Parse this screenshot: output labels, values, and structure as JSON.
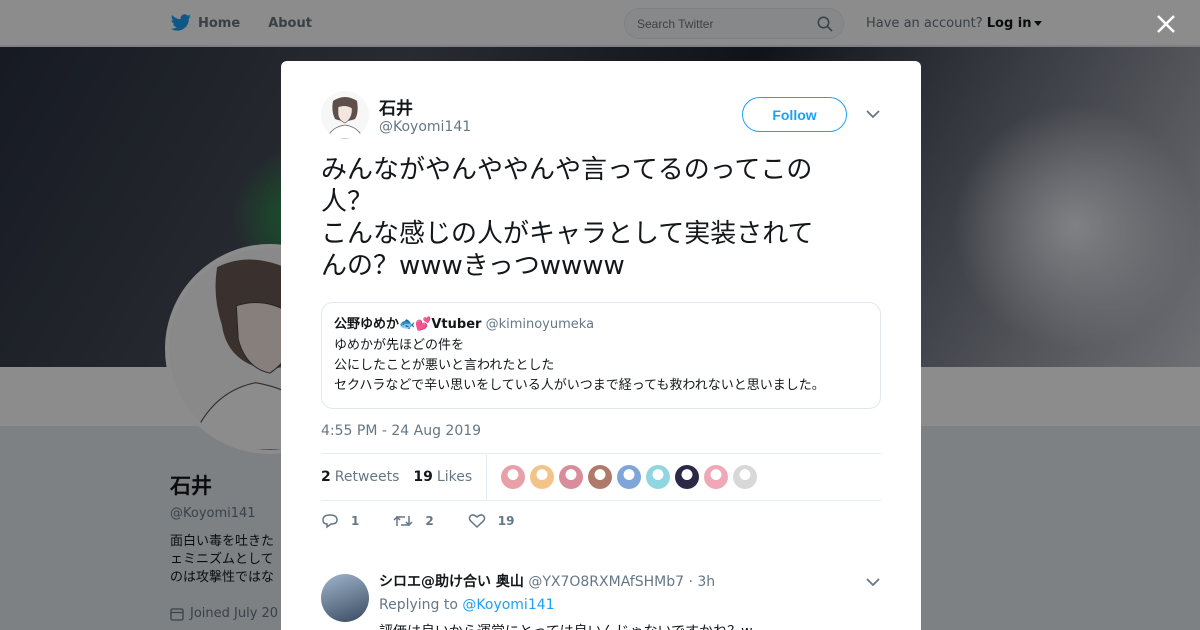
{
  "nav": {
    "home": "Home",
    "about": "About",
    "search_placeholder": "Search Twitter",
    "account_prompt": "Have an account?",
    "login": "Log in"
  },
  "profile": {
    "name": "石井",
    "handle": "@Koyomi141",
    "bio": "面白い毒を吐きた\nェミニズムとして\nのは攻撃性ではな",
    "joined": "Joined July 20"
  },
  "tweet": {
    "name": "石井",
    "handle": "@Koyomi141",
    "follow": "Follow",
    "text": "みんながやんややんや言ってるのってこの\n人？\nこんな感じの人がキャラとして実装されて\nんの？wwwきっつwwww",
    "time": "4:55 PM - 24 Aug 2019",
    "retweets_count": "2",
    "retweets_label": "Retweets",
    "likes_count": "19",
    "likes_label": "Likes",
    "reply_action": "1",
    "retweet_action": "2",
    "like_action": "19"
  },
  "quote": {
    "name": "公野ゆめか🐟💕Vtuber",
    "handle": "@kiminoyumeka",
    "text": "ゆめかが先ほどの件を\n公にしたことが悪いと言われたとした\nセクハラなどで辛い思いをしている人がいつまで経っても救われないと思いました。"
  },
  "reply": {
    "name": "シロエ@助け合い 奥山",
    "handle": "@YX7O8RXMAfSHMb7",
    "time": "· 3h",
    "replying_prefix": "Replying to",
    "replying_to": "@Koyomi141",
    "text": "評価は良いから運営にとっては良いんじゃないですかね？w"
  },
  "likers": [
    "#e8a0a8",
    "#f2c48a",
    "#d98c9a",
    "#b07a6a",
    "#7fa6d9",
    "#8fd6e0",
    "#2a2a48",
    "#f0a7b8",
    "#d8d8d8"
  ],
  "colors": {
    "accent": "#1da1f2",
    "twitter_blue": "#1da1f2"
  }
}
